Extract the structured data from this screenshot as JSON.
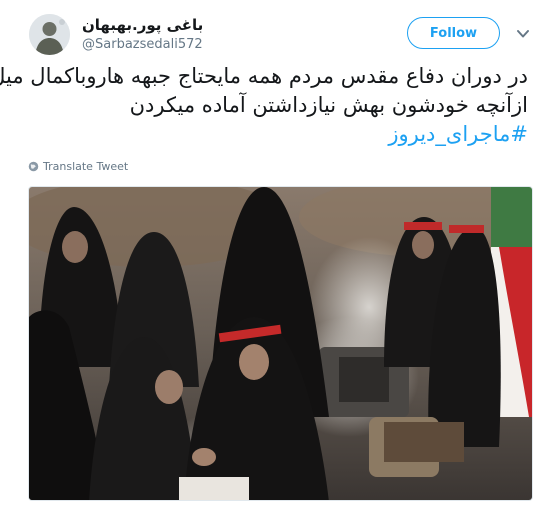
{
  "author": {
    "name": "باغی پور.بهبهان",
    "handle": "@Sarbazsedali572"
  },
  "follow_label": "Follow",
  "tweet": {
    "line1": "در دوران دفاع مقدس مردم همه مایحتاج جبهه هاروباکمال میل",
    "line2": "ازآنچه خودشون بهش نیازداشتن آماده میکردن",
    "hashtag": "#ماجرای_دیروز"
  },
  "translate_label": "Translate Tweet",
  "colors": {
    "accent": "#1da1f2",
    "text": "#14171a",
    "secondary": "#657786"
  },
  "icons": {
    "more": "chevron-down-icon",
    "translate": "globe-icon"
  }
}
